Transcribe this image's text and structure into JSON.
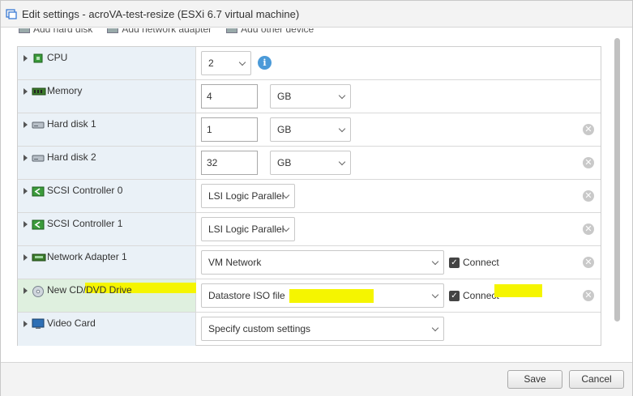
{
  "window": {
    "title": "Edit settings - acroVA-test-resize (ESXi 6.7 virtual machine)"
  },
  "toolbar": {
    "add_hard_disk": "Add hard disk",
    "add_network_adapter": "Add network adapter",
    "add_other_device": "Add other device"
  },
  "rows": [
    {
      "label": "CPU",
      "icon": "cpu-icon",
      "select_value": "2"
    },
    {
      "label": "Memory",
      "icon": "memory-icon",
      "input_value": "4",
      "unit": "GB"
    },
    {
      "label": "Hard disk 1",
      "icon": "hard-disk-icon",
      "input_value": "1",
      "unit": "GB"
    },
    {
      "label": "Hard disk 2",
      "icon": "hard-disk-icon",
      "input_value": "32",
      "unit": "GB"
    },
    {
      "label": "SCSI Controller 0",
      "icon": "scsi-controller-icon",
      "select_value": "LSI Logic Parallel"
    },
    {
      "label": "SCSI Controller 1",
      "icon": "scsi-controller-icon",
      "select_value": "LSI Logic Parallel"
    },
    {
      "label": "Network Adapter 1",
      "icon": "network-adapter-icon",
      "select_value": "VM Network",
      "checkbox_label": "Connect"
    },
    {
      "label": "New CD/DVD Drive",
      "icon": "cd-dvd-icon",
      "select_value": "Datastore ISO file",
      "checkbox_label": "Connect"
    },
    {
      "label": "Video Card",
      "icon": "video-card-icon",
      "select_value": "Specify custom settings"
    }
  ],
  "footer": {
    "save_label": "Save",
    "cancel_label": "Cancel"
  },
  "colors": {
    "label_bg": "#eaf1f7",
    "highlight_bg": "#dff0df",
    "redaction": "#f5f500",
    "info_blue": "#4b9ad8"
  }
}
